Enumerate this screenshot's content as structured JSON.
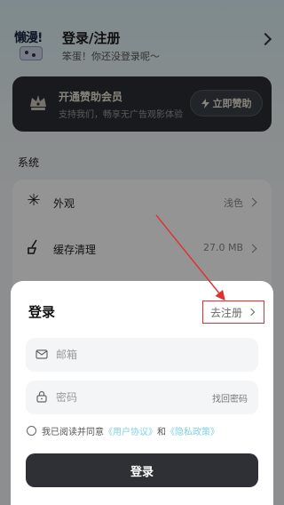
{
  "profile": {
    "avatar_text": "懒漫!",
    "title": "登录/注册",
    "subtitle": "笨蛋！你还没登录呢～"
  },
  "vip": {
    "title": "开通赞助会员",
    "subtitle": "支持我们，畅享无广告观影体验",
    "button": "立即赞助"
  },
  "section_title": "系统",
  "settings": [
    {
      "label": "外观",
      "value": "浅色",
      "icon": "appearance-icon"
    },
    {
      "label": "缓存清理",
      "value": "27.0 MB",
      "icon": "broom-icon"
    }
  ],
  "login": {
    "title": "登录",
    "register_link": "去注册",
    "email_placeholder": "邮箱",
    "password_placeholder": "密码",
    "forgot": "找回密码",
    "agree_prefix": "我已阅读并同意",
    "user_agreement": "《用户协议》",
    "and": "和",
    "privacy_policy": "《隐私政策》",
    "button": "登录"
  },
  "colors": {
    "overlay": "#00000066",
    "link": "#7fd0e4",
    "annotation": "#e03030",
    "button": "#2e3035"
  }
}
